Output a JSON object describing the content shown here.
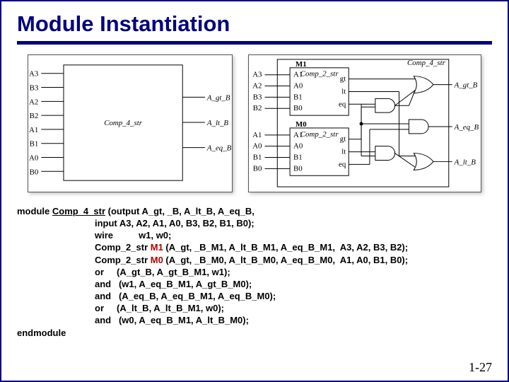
{
  "title": "Module Instantiation",
  "page_number": "1-27",
  "left_diagram": {
    "block_name": "Comp_4_str",
    "inputs": [
      "A3",
      "B3",
      "A2",
      "B2",
      "A1",
      "B1",
      "A0",
      "B0"
    ],
    "outputs": [
      "A_gt_B",
      "A_lt_B",
      "A_eq_B"
    ]
  },
  "right_diagram": {
    "outer_block": "Comp_4_str",
    "sub_blocks": [
      {
        "inst": "M1",
        "type": "Comp_2_str",
        "ins": [
          "A1",
          "A0",
          "B1",
          "B0"
        ],
        "outs": [
          "gt",
          "lt",
          "eq"
        ]
      },
      {
        "inst": "M0",
        "type": "Comp_2_str",
        "ins": [
          "A1",
          "A0",
          "B1",
          "B0"
        ],
        "outs": [
          "gt",
          "lt",
          "eq"
        ]
      }
    ],
    "inputs": [
      "A3",
      "A2",
      "B3",
      "B2",
      "A1",
      "A0",
      "B1",
      "B0"
    ],
    "outputs": [
      "A_gt_B",
      "A_lt_B",
      "A_eq_B"
    ]
  },
  "code": {
    "module_kw": "module",
    "module_name": "Comp_4_str",
    "sig_open": " (output A_gt, _B, A_lt_B, A_eq_B,",
    "l2": "input A3, A2, A1, A0, B3, B2, B1, B0);",
    "l3": "wire          w1, w0;",
    "l4a": "Comp_2_str ",
    "l4inst": "M1",
    "l4b": " (A_gt, _B_M1, A_lt_B_M1, A_eq_B_M1,  A3, A2, B3, B2);",
    "l5a": "Comp_2_str ",
    "l5inst": "M0",
    "l5b": " (A_gt, _B_M0, A_lt_B_M0, A_eq_B_M0,  A1, A0, B1, B0);",
    "l6": "or     (A_gt_B, A_gt_B_M1, w1);",
    "l7": "and   (w1, A_eq_B_M1, A_gt_B_M0);",
    "l8": "and   (A_eq_B, A_eq_B_M1, A_eq_B_M0);",
    "l9": "or     (A_lt_B, A_lt_B_M1, w0);",
    "l10": "and   (w0, A_eq_B_M1, A_lt_B_M0);",
    "end_kw": "endmodule"
  }
}
